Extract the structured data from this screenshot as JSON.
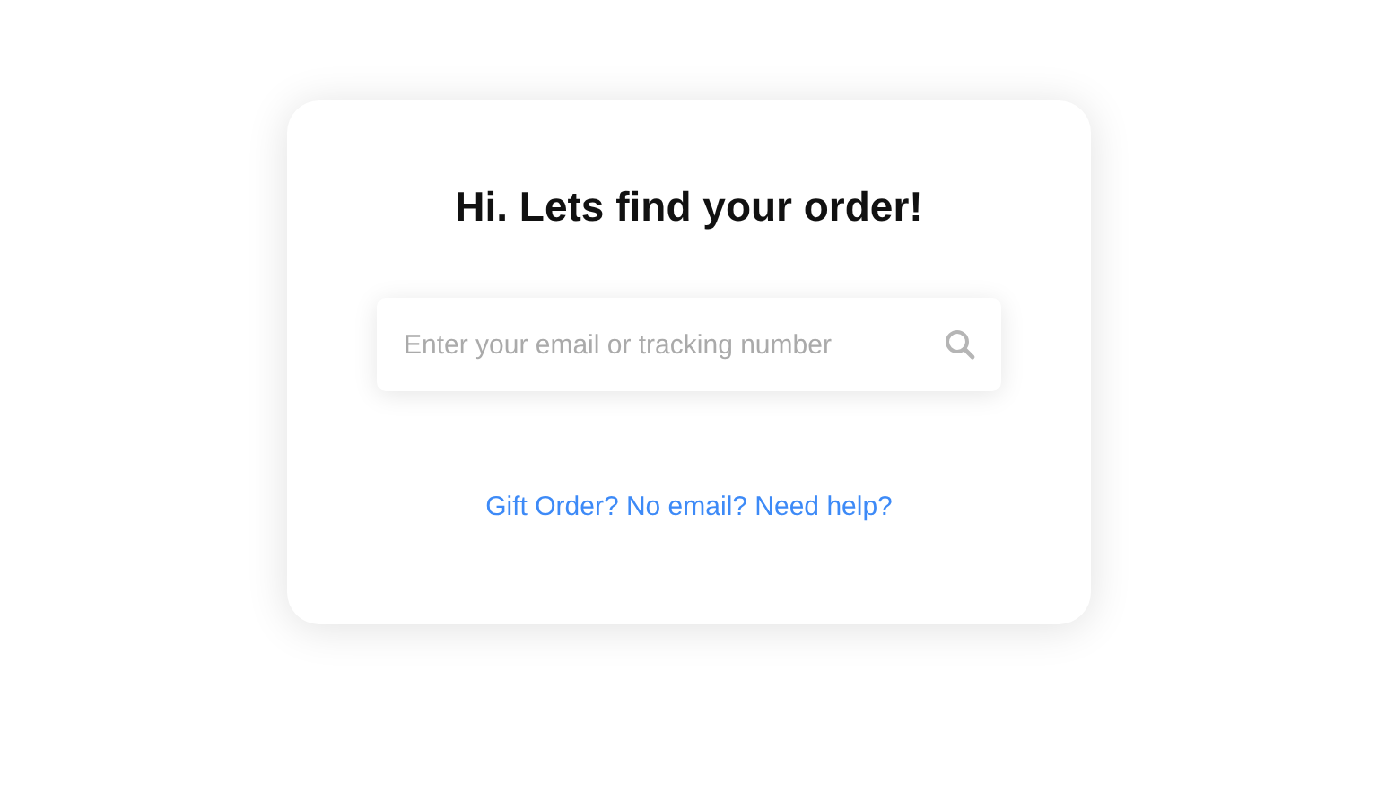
{
  "card": {
    "title": "Hi. Lets find your order!",
    "search": {
      "placeholder": "Enter your email or tracking number"
    },
    "help_link": "Gift Order? No email? Need help?"
  }
}
